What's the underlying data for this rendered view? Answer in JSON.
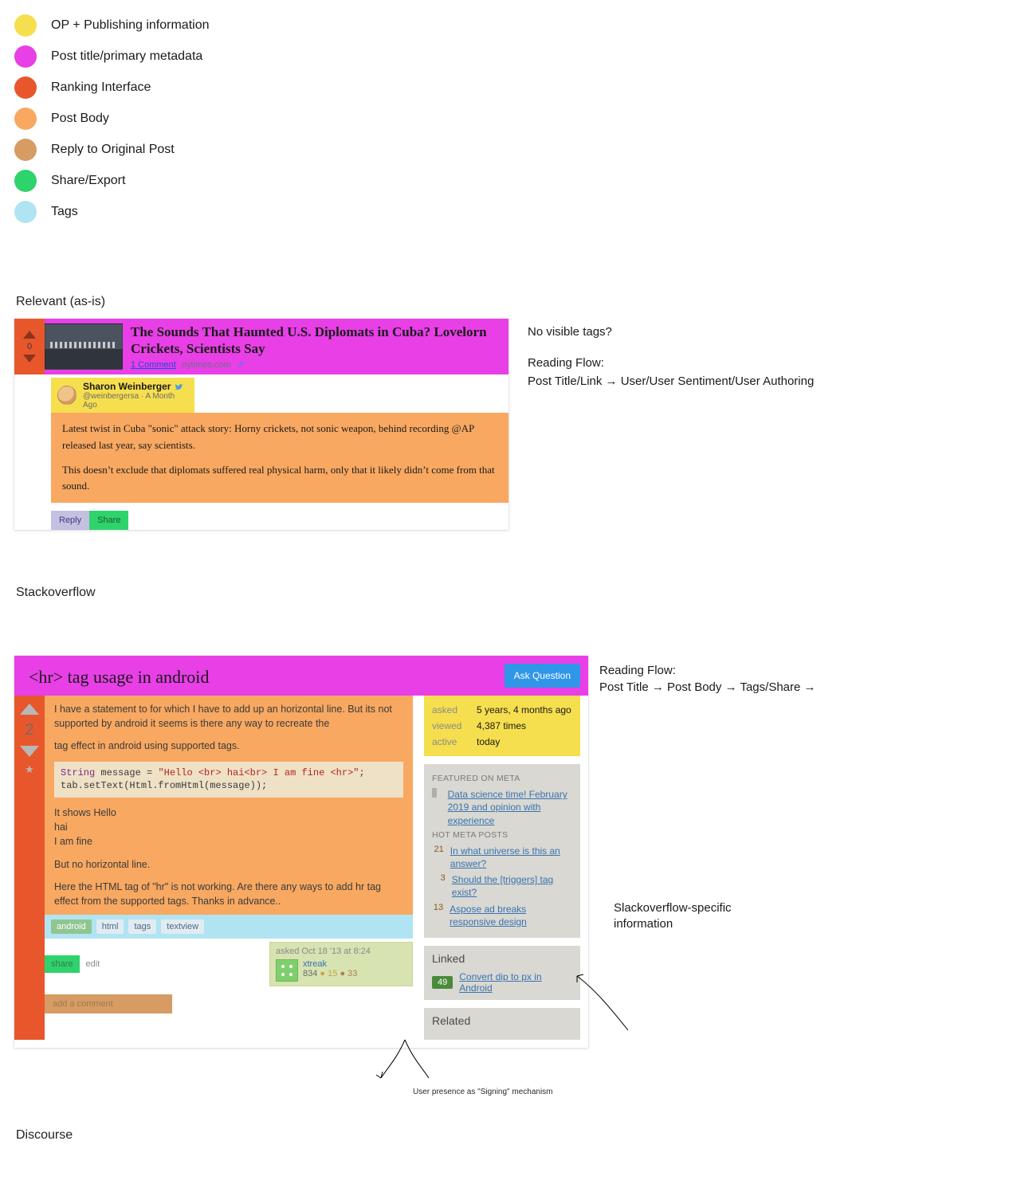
{
  "legend": {
    "items": [
      {
        "color": "#f6df4e",
        "label": "OP + Publishing information"
      },
      {
        "color": "#e83fe6",
        "label": "Post title/primary metadata"
      },
      {
        "color": "#e8572c",
        "label": "Ranking Interface"
      },
      {
        "color": "#f8a861",
        "label": "Post Body"
      },
      {
        "color": "#d69c63",
        "label": "Reply to Original Post"
      },
      {
        "color": "#2fd36b",
        "label": "Share/Export"
      },
      {
        "color": "#b1e4f2",
        "label": "Tags"
      }
    ]
  },
  "relevant": {
    "heading": "Relevant (as-is)",
    "rank": "0",
    "title": "The Sounds That Haunted U.S. Diplomats in Cuba? Lovelorn Crickets, Scientists Say",
    "comment_link": "1 Comment",
    "source": "nytimes.com",
    "ext": "↗",
    "author": {
      "name": "Sharon Weinberger",
      "handle": "@weinbergersa",
      "time": "A Month Ago"
    },
    "body_p1": "Latest twist in Cuba \"sonic\" attack story: Horny crickets, not sonic weapon, behind recording @AP released last year, say scientists.",
    "body_p2": "This doesn’t exclude that diplomats suffered real physical harm, only that it likely didn’t come from that sound.",
    "actions": {
      "reply": "Reply",
      "share": "Share"
    },
    "notes": {
      "question": "No visible tags?",
      "flow_h": "Reading Flow:",
      "flow": "Post Title/Link → User/User Sentiment/User Authoring"
    }
  },
  "stackoverflow": {
    "heading": "Stackoverflow",
    "title": "<hr> tag usage in android",
    "ask": "Ask Question",
    "rank": "2",
    "body": {
      "p1": "I have a statement to for which I have to add up an horizontal line. But its not supported by android it seems is there any way to recreate the",
      "p2": "tag effect in android using supported tags.",
      "code_1": "String",
      "code_2": " message = ",
      "code_3": "\"Hello <br> hai<br> I am fine <hr>\"",
      "code_4": ";",
      "code_5": "tab.setText(Html.fromHtml(message));",
      "p3": "It shows Hello",
      "p4": "hai",
      "p5": "I am fine",
      "p6": "But no horizontal line.",
      "p7": "Here the HTML tag of \"hr\" is not working. Are there any ways to add hr tag effect from the supported tags. Thanks in advance.."
    },
    "tags": [
      "android",
      "html",
      "tags",
      "textview"
    ],
    "share": "share",
    "edit": "edit",
    "signed": {
      "when": "asked Oct 18 '13 at 8:24",
      "user": "xtreak",
      "rep": "834",
      "gold": "15",
      "bronze": "33"
    },
    "add_comment": "add a comment",
    "stats": {
      "asked_k": "asked",
      "asked_v": "5 years, 4 months ago",
      "viewed_k": "viewed",
      "viewed_v": "4,387 times",
      "active_k": "active",
      "active_v": "today"
    },
    "featured_h": "FEATURED ON META",
    "featured_link": "Data science time! February 2019 and opinion with experience",
    "hot_h": "HOT META POSTS",
    "hot": [
      {
        "n": "21",
        "t": "In what universe is this an answer?"
      },
      {
        "n": "3",
        "t": "Should the [triggers] tag exist?"
      },
      {
        "n": "13",
        "t": "Aspose ad breaks responsive design"
      }
    ],
    "linked_h": "Linked",
    "linked": {
      "n": "49",
      "t": "Convert dip to px in Android"
    },
    "related_h": "Related",
    "notes": {
      "flow_h": "Reading Flow:",
      "flow": "Post Title → Post Body → Tags/Share →"
    },
    "side_label": "Slackoverflow-specific information",
    "caption": "User presence as \"Signing\" mechanism"
  },
  "discourse": {
    "heading": "Discourse"
  }
}
